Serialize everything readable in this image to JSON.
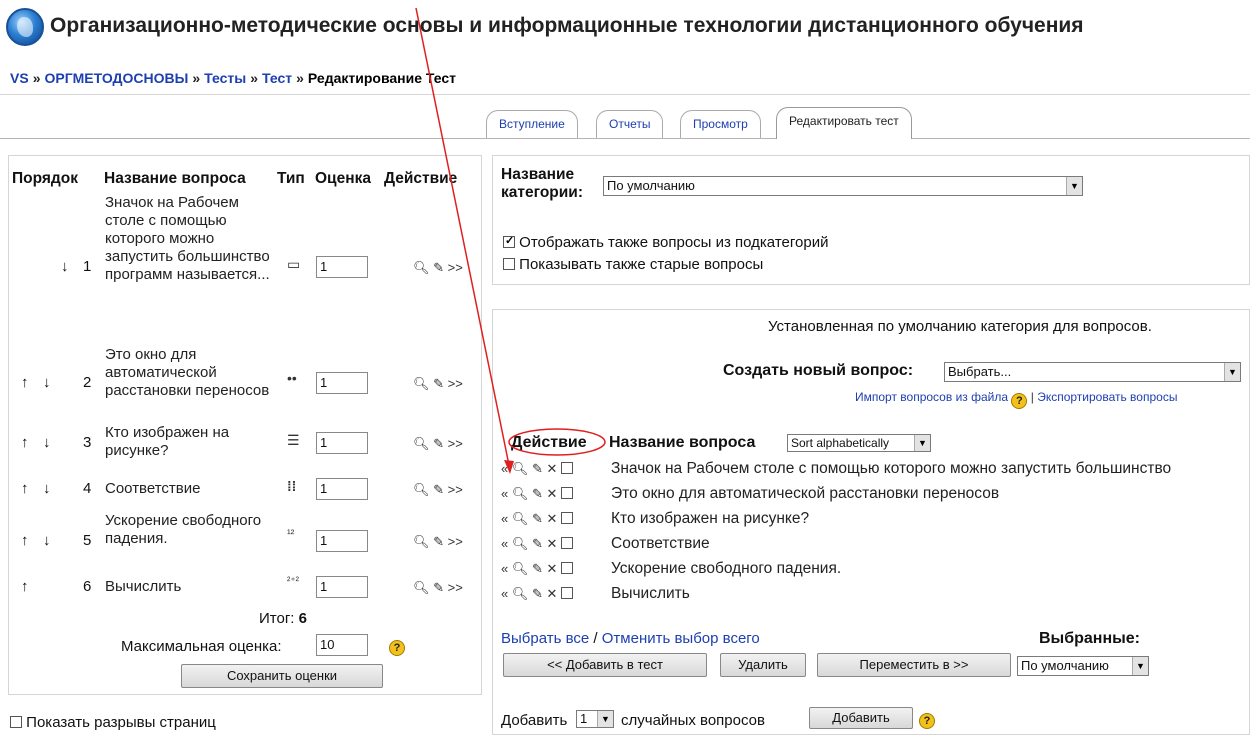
{
  "header": {
    "title": "Организационно-методические основы и информационные технологии дистанционного обучения"
  },
  "breadcrumb": [
    "VS",
    "ОРГМЕТОДОСНОВЫ",
    "Тесты",
    "Тест",
    "Редактирование Тест"
  ],
  "breadcrumb_sep": "»",
  "tabs": [
    "Вступление",
    "Отчеты",
    "Просмотр",
    "Редактировать тест"
  ],
  "left": {
    "headers": [
      "Порядок",
      "Название вопроса",
      "Тип",
      "Оценка",
      "Действие"
    ],
    "questions": [
      {
        "num": "1",
        "up": false,
        "down": true,
        "name": "Значок на Рабочем столе с помощью которого можно запустить большинство программ называется...",
        "grade": "1",
        "type_icon": "short-answer-icon"
      },
      {
        "num": "2",
        "up": true,
        "down": true,
        "name": "Это окно для автоматической расстановки переносов",
        "grade": "1",
        "type_icon": "multichoice-icon"
      },
      {
        "num": "3",
        "up": true,
        "down": true,
        "name": "Кто изображен на рисунке?",
        "grade": "1",
        "type_icon": "list-icon"
      },
      {
        "num": "4",
        "up": true,
        "down": true,
        "name": "Соответствие",
        "grade": "1",
        "type_icon": "matching-icon"
      },
      {
        "num": "5",
        "up": true,
        "down": true,
        "name": "Ускорение свободного падения.",
        "grade": "1",
        "type_icon": "numerical-icon"
      },
      {
        "num": "6",
        "up": true,
        "down": false,
        "name": "Вычислить",
        "grade": "1",
        "type_icon": "calculated-icon"
      }
    ],
    "total_label": "Итог:",
    "total_value": "6",
    "max_grade_label": "Максимальная оценка:",
    "max_grade_value": "10",
    "save_button": "Сохранить оценки",
    "show_page_breaks": "Показать разрывы страниц"
  },
  "category": {
    "label": "Название категории:",
    "selected": "По умолчанию",
    "show_subcats": "Отображать также вопросы из подкатегорий",
    "show_subcats_checked": true,
    "show_old": "Показывать также старые вопросы",
    "show_old_checked": false
  },
  "bank": {
    "default_info": "Установленная по умолчанию категория для вопросов.",
    "create_label": "Создать новый вопрос:",
    "create_selected": "Выбрать...",
    "import_link": "Импорт вопросов из файла",
    "export_link": "Экспортировать вопросы",
    "action_header": "Действие",
    "name_header": "Название вопроса",
    "sort_selected": "Sort alphabetically",
    "questions": [
      "Значок на Рабочем столе с помощью которого можно запустить большинство",
      "Это окно для автоматической расстановки переносов",
      "Кто изображен на рисунке?",
      "Соответствие",
      "Ускорение свободного падения.",
      "Вычислить"
    ],
    "select_all": "Выбрать все",
    "deselect_all": "Отменить выбор всего",
    "selected_label": "Выбранные:",
    "add_to_quiz": "<< Добавить в тест",
    "delete": "Удалить",
    "move_to": "Переместить в >>",
    "move_target": "По умолчанию",
    "add_label": "Добавить",
    "random_count": "1",
    "random_label": "случайных вопросов",
    "add_button": "Добавить"
  }
}
